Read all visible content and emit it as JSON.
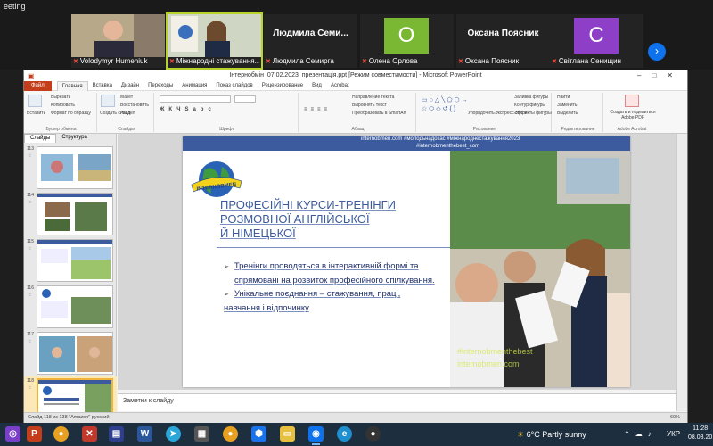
{
  "zoom": {
    "window_title": "eeting",
    "participants": [
      {
        "name": "Volodymyr Humeniuk",
        "video": true
      },
      {
        "name": "Міжнародні стажування...",
        "video": true,
        "active": true
      },
      {
        "display": "Людмила  Семи...",
        "name": "Людмила Семирга",
        "video": false
      },
      {
        "initial": "О",
        "name": "Олена Орлова",
        "video": false,
        "color": "#7ab834"
      },
      {
        "display": "Оксана Поясник",
        "name": "Оксана Поясник",
        "video": false
      },
      {
        "initial": "С",
        "name": "Світлана Сенищин",
        "video": false,
        "color": "#8e3fc8"
      }
    ],
    "next_arrow": "›"
  },
  "ppt": {
    "title": "Інтернобмін_07.02.2023_презентація.ppt [Режим совместимости] - Microsoft PowerPoint",
    "menu": {
      "file": "Файл",
      "tabs": [
        "Главная",
        "Вставка",
        "Дизайн",
        "Переходы",
        "Анимация",
        "Показ слайдов",
        "Рецензирование",
        "Вид",
        "Acrobat"
      ]
    },
    "ribbon": {
      "paste": "Вставить",
      "cut": "Вырезать",
      "copy": "Копировать",
      "format_painter": "Формат по образцу",
      "clipboard": "Буфер обмена",
      "new_slide": "Создать слайд",
      "layout": "Макет",
      "reset": "Восстановить",
      "section": "Раздел",
      "slides": "Слайды",
      "font": "Шрифт",
      "text_dir": "Направление текста",
      "align_text": "Выровнять текст",
      "smartart": "Преобразовать в SmartArt",
      "paragraph": "Абзац",
      "arrange": "Упорядочить",
      "quick_styles": "Экспресс-стили",
      "fill": "Заливка фигуры",
      "outline": "Контур фигуры",
      "effects": "Эффекты фигуры",
      "drawing": "Рисование",
      "find": "Найти",
      "replace": "Заменить",
      "select": "Выделить",
      "editing": "Редактирование",
      "create_pdf": "Создать и поделиться Adobe PDF",
      "acrobat": "Adobe Acrobat"
    },
    "left_tabs": [
      "Слайды",
      "Структура"
    ],
    "thumbnails": [
      {
        "num": "113"
      },
      {
        "num": "114"
      },
      {
        "num": "115"
      },
      {
        "num": "116"
      },
      {
        "num": "117"
      },
      {
        "num": "118",
        "selected": true
      }
    ],
    "slide": {
      "header_line1": "internobmen.com   #молодьнадокас   #міжнароднестажування2023",
      "header_line2": "#internobmenthebest_com",
      "logo_text": "INTERNOBMEN",
      "title_lines": [
        "ПРОФЕСІЙНІ  КУРСИ-ТРЕНІНГИ",
        "РОЗМОВНОЇ  АНГЛІЙСЬКОЇ",
        "Й НІМЕЦЬКОЇ"
      ],
      "bullets": [
        {
          "lines": [
            "Тренінги проводяться в інтерактивній формі та",
            "спрямовані на розвиток  професійного спілкування."
          ]
        },
        {
          "lines": [
            "Унікальне поєднання – стажування, праці,",
            "навчання і відпочинку"
          ]
        }
      ],
      "photo_overlay1": "#internobmenthebest",
      "photo_overlay2": "internobmen.com"
    },
    "notes": "Заметки к слайду",
    "status": "Слайд 118 из 138    \"Amazon\"    русский",
    "zoom": "60%"
  },
  "taskbar": {
    "weather": "6°C  Partly sunny",
    "lang": "УКР",
    "time": "11:28",
    "date": "08.03.20"
  }
}
